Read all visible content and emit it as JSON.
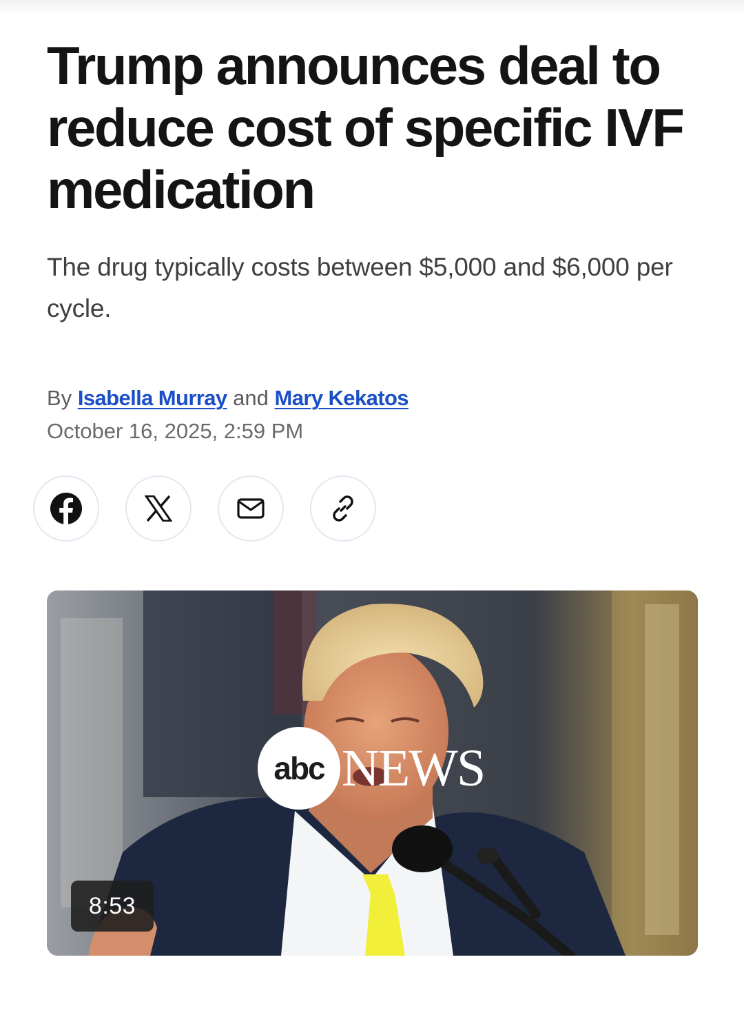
{
  "article": {
    "headline": "Trump announces deal to reduce cost of specific IVF medication",
    "subheadline": "The drug typically costs between $5,000 and $6,000 per cycle.",
    "byline": {
      "prefix": "By",
      "author_1": "Isabella Murray",
      "joiner": "and",
      "author_2": "Mary Kekatos"
    },
    "date": "October 16, 2025, 2:59 PM"
  },
  "share": {
    "buttons": [
      {
        "icon": "facebook-icon"
      },
      {
        "icon": "x-icon"
      },
      {
        "icon": "email-icon"
      },
      {
        "icon": "link-icon"
      }
    ]
  },
  "video": {
    "logo_mark": "abc",
    "logo_word": "NEWS",
    "duration": "8:53"
  },
  "colors": {
    "link": "#1a4fc8",
    "headline": "#141414",
    "button_border": "#e3e8f0",
    "tie": "#f2ef3a"
  }
}
